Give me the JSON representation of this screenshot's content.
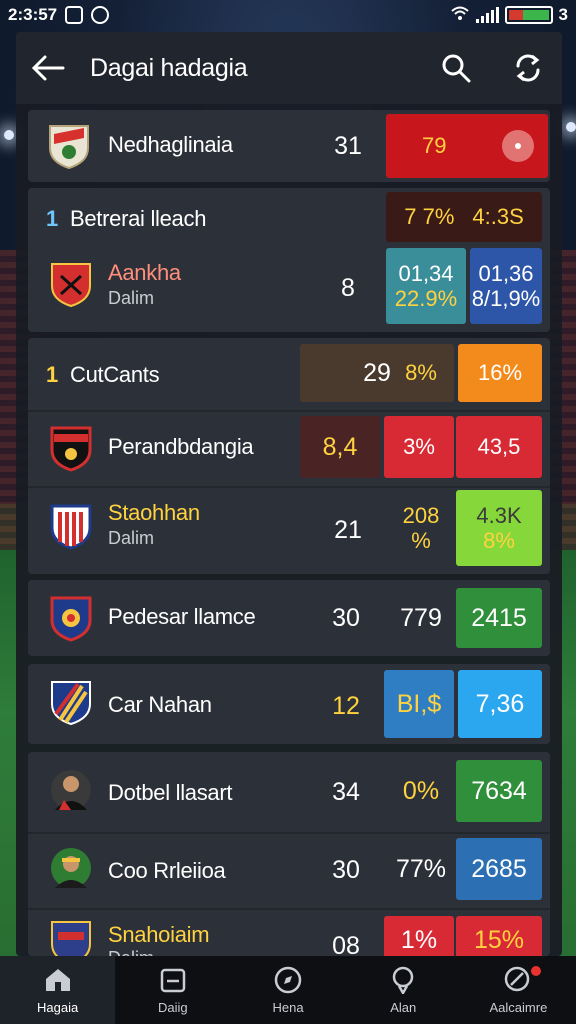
{
  "status_bar": {
    "time": "2:3:57",
    "battery_label": "3"
  },
  "header": {
    "title": "Dagai hadagia"
  },
  "rows": [
    {
      "name": "Nedhaglinaia",
      "num": "31",
      "cell1": "79",
      "cell1_color": "#c8161d"
    },
    {
      "rank": "1",
      "name": "Betrerai lleach",
      "cell1": "7 7%",
      "cell2": "4:.3S"
    },
    {
      "name": "Aankha",
      "sub": "Dalim",
      "num": "8",
      "cell1a": "01,34",
      "cell1b": "22.9%",
      "cell2a": "01,36",
      "cell2b": "8/1,9%"
    },
    {
      "rank": "1",
      "name": "CutCants",
      "num": "29",
      "cell1": "8%",
      "cell2": "16%"
    },
    {
      "name": "Perandbdangia",
      "num": "8,4",
      "cell1": "3%",
      "cell2": "43,5"
    },
    {
      "name": "Staohhan",
      "sub": "Dalim",
      "num": "21",
      "cell1a": "208",
      "cell1b": "%",
      "cell2a": "4.3K",
      "cell2b": "8%"
    },
    {
      "name": "Pedesar llamce",
      "num": "30",
      "cell1": "779",
      "cell2": "2415"
    },
    {
      "name": "Car Nahan",
      "num": "12",
      "cell1": "BI,$",
      "cell2": "7,36"
    },
    {
      "name": "Dotbel llasart",
      "num": "34",
      "cell1": "0%",
      "cell2": "7634"
    },
    {
      "name": "Coo Rrleiioa",
      "num": "30",
      "cell1": "77%",
      "cell2": "2685"
    },
    {
      "name": "Snahoiaim",
      "sub": "Dalim",
      "num": "08",
      "cell1": "1%",
      "cell2": "15%"
    }
  ],
  "bottom_nav": [
    {
      "label": "Hagaia",
      "icon": "home-icon"
    },
    {
      "label": "Daiig",
      "icon": "calendar-icon"
    },
    {
      "label": "Hena",
      "icon": "compass-icon"
    },
    {
      "label": "Alan",
      "icon": "ball-icon"
    },
    {
      "label": "Aalcaimre",
      "icon": "search-alert-icon"
    }
  ],
  "colors": {
    "red": "#d82a35",
    "dark_red": "#3a1a17",
    "teal": "#3a8e9a",
    "blue": "#2f7dc3",
    "orange": "#f28a1c",
    "lime": "#86d83a",
    "green": "#2f8f3a",
    "sky": "#2aa7ee",
    "yellow_text": "#ffd23f"
  }
}
